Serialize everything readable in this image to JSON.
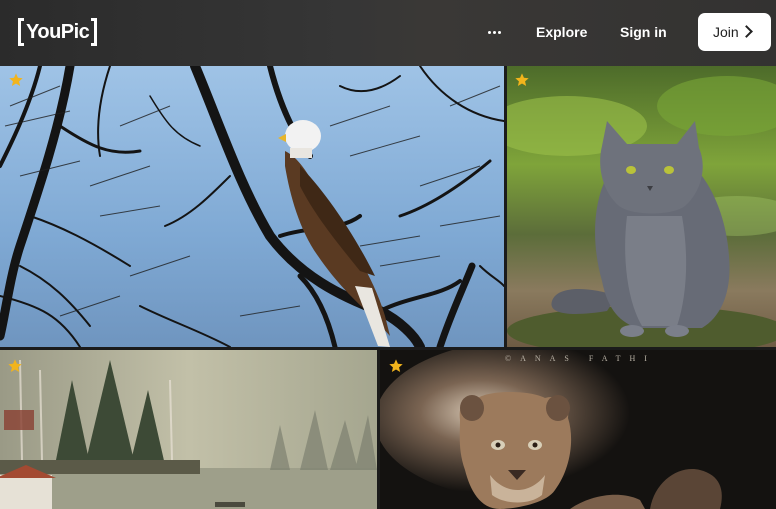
{
  "header": {
    "logo_text": "YouPic",
    "more_icon": "ellipsis-icon",
    "nav": {
      "explore": "Explore",
      "sign_in": "Sign in",
      "join": "Join"
    },
    "join_icon": "chevron-right-icon"
  },
  "photos": [
    {
      "subject": "bald eagle perched on bare tree branches",
      "featured": true
    },
    {
      "subject": "grey cat sitting on ground in green field",
      "featured": true
    },
    {
      "subject": "foggy lake shore with trees and red house",
      "featured": true
    },
    {
      "subject": "lion cub portrait on dark background",
      "featured": true,
      "watermark": "©ANAS FATHI"
    }
  ],
  "colors": {
    "header_bg": "#333333",
    "join_bg": "#ffffff",
    "star": "#f2b41c"
  }
}
